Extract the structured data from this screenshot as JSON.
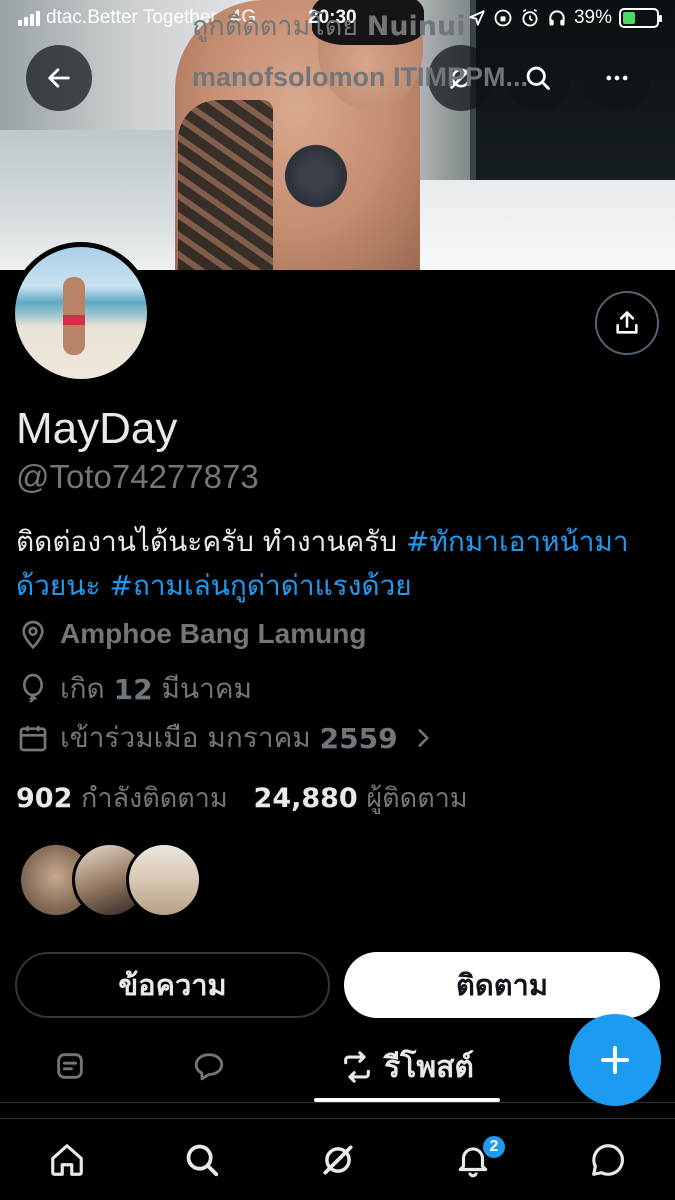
{
  "status_bar": {
    "carrier": "dtac.Better Together",
    "network": "4G",
    "time": "20:30",
    "battery_percent": "39%",
    "battery_level": 0.39
  },
  "profile": {
    "display_name": "MayDay",
    "handle": "@Toto74277873",
    "bio_text": "ติดต่องานได้นะครับ ทำงานครับ ",
    "bio_hashtag_1": "#ทักมาเอาหน้ามาด้วยนะ",
    "bio_hashtag_2": "#ถามเล่นกูด่าด่าแรงด้วย",
    "location": "Amphoe Bang Lamung",
    "birth_label": "เกิด",
    "birth_day": "12",
    "birth_month": "มีนาคม",
    "joined_label": "เข้าร่วมเมือ มกราคม",
    "joined_year": "2559",
    "following_count": "902",
    "following_label": "กำลังติดตาม",
    "followers_count": "24,880",
    "followers_label": "ผู้ติดตาม",
    "followed_by_label": "ถูกติดตามโดย",
    "followed_by_name_1": "Nuinui",
    "followed_by_more": "manofsolomon ITIMPPM..."
  },
  "actions": {
    "message_label": "ข้อความ",
    "follow_label": "ติดตาม"
  },
  "tabs": {
    "active_label": "รีโพสต์"
  },
  "notifications": {
    "badge_count": "2"
  },
  "icons": {
    "back": "arrow-left-icon",
    "grok": "grok-icon",
    "search": "search-icon",
    "more": "more-icon",
    "share": "share-icon",
    "location": "location-pin-icon",
    "birthday": "balloon-icon",
    "calendar": "calendar-icon",
    "compose": "plus-icon"
  },
  "colors": {
    "accent": "#1d9bf0",
    "background": "#000000",
    "secondary_text": "#71767b"
  }
}
